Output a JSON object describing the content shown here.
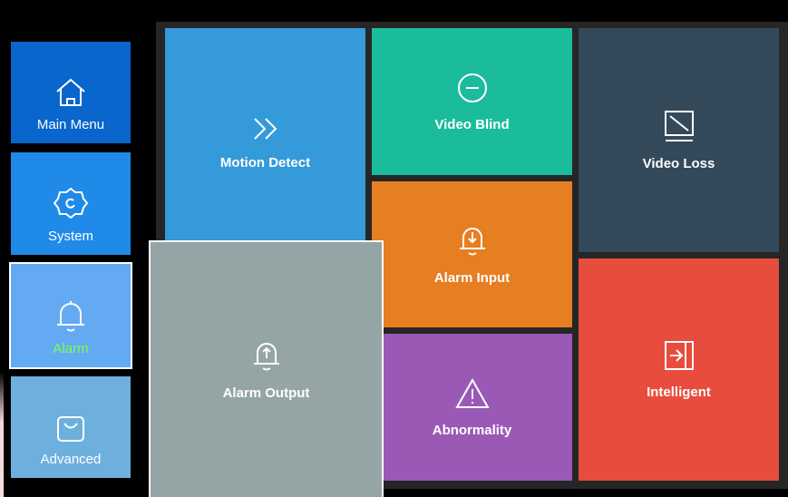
{
  "sidebar": {
    "items": [
      {
        "label": "Main Menu",
        "icon": "home-icon",
        "color": "#0866cc"
      },
      {
        "label": "System",
        "icon": "gear-icon",
        "color": "#1f8ae8"
      },
      {
        "label": "Alarm",
        "icon": "bell-icon",
        "color": "#64aaf2",
        "active": true,
        "label_color": "#7cff4d"
      },
      {
        "label": "Advanced",
        "icon": "bag-icon",
        "color": "#6db0de"
      }
    ]
  },
  "tiles": [
    {
      "label": "Motion Detect",
      "icon": "double-chevron-right-icon",
      "color": "#349ad9"
    },
    {
      "label": "Video Blind",
      "icon": "circle-minus-icon",
      "color": "#1abc9c"
    },
    {
      "label": "Video Loss",
      "icon": "screen-slash-icon",
      "color": "#344959"
    },
    {
      "label": "Alarm Input",
      "icon": "bell-arrow-down-icon",
      "color": "#e67e22"
    },
    {
      "label": "Alarm Output",
      "icon": "bell-arrow-up-icon",
      "color": "#95a5a6",
      "selected": true
    },
    {
      "label": "Abnormality",
      "icon": "warning-triangle-icon",
      "color": "#9b59b6"
    },
    {
      "label": "Intelligent",
      "icon": "enter-box-icon",
      "color": "#e74c3c"
    }
  ]
}
